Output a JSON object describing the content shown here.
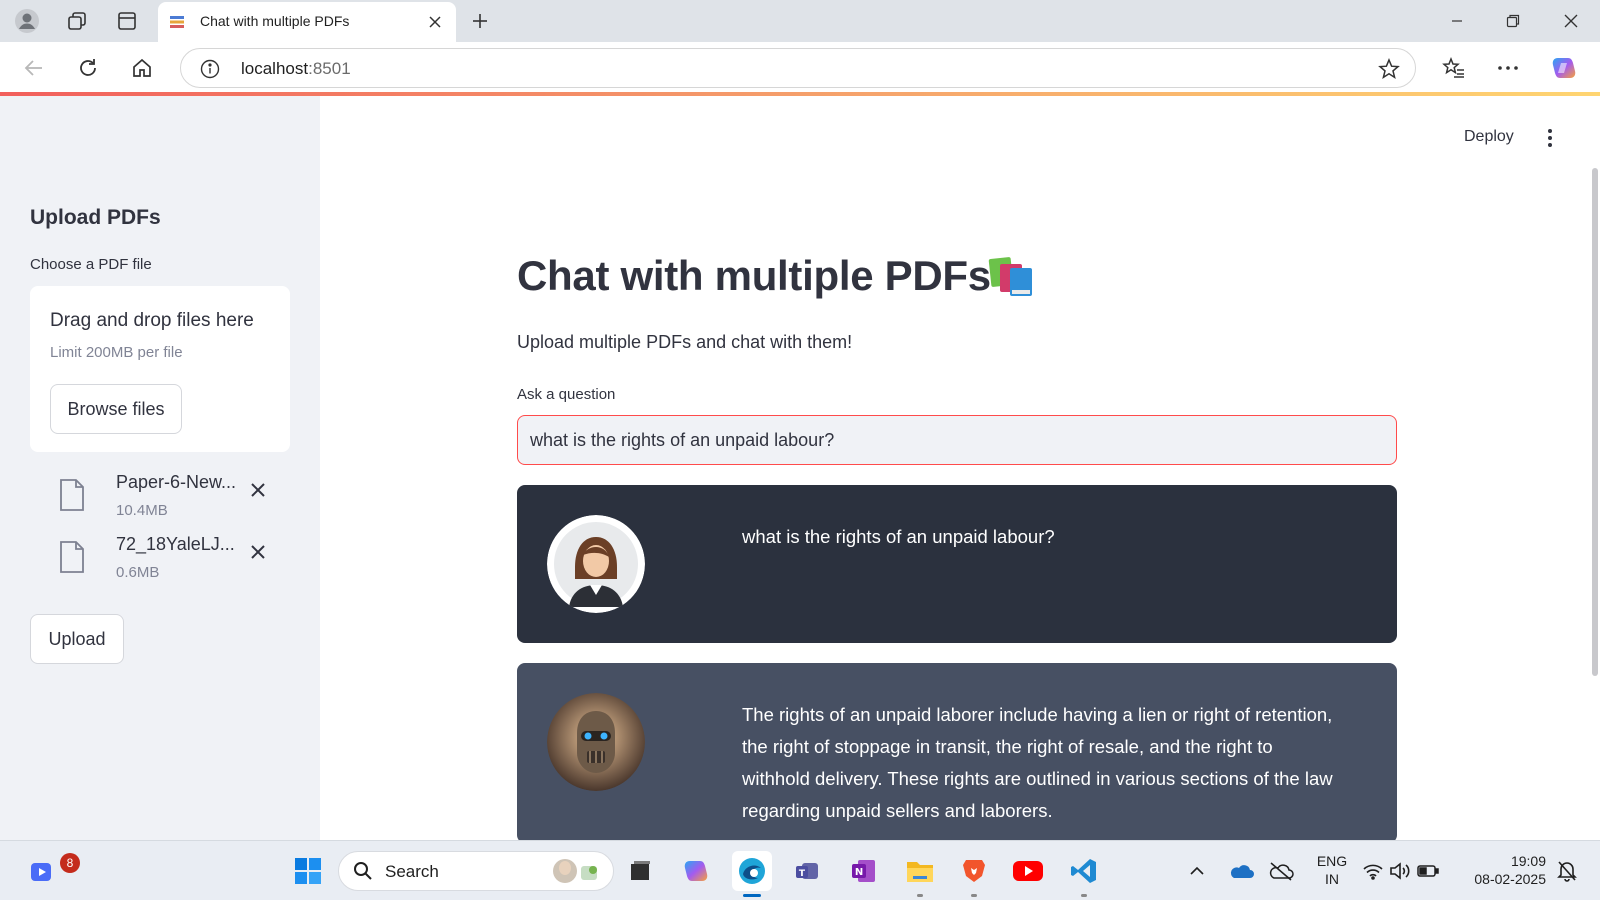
{
  "browser": {
    "tab_title": "Chat with multiple PDFs",
    "url_host": "localhost",
    "url_port": ":8501"
  },
  "app": {
    "deploy_label": "Deploy",
    "title": "Chat with multiple PDFs",
    "subtitle": "Upload multiple PDFs and chat with them!",
    "question_label": "Ask a question",
    "question_value": "what is the rights of an unpaid labour?"
  },
  "sidebar": {
    "title": "Upload PDFs",
    "uploader_label": "Choose a PDF file",
    "dropzone_title": "Drag and drop files here",
    "dropzone_limit": "Limit 200MB per file",
    "browse_label": "Browse files",
    "files": [
      {
        "name": "Paper-6-New...",
        "size": "10.4MB"
      },
      {
        "name": "72_18YaleLJ...",
        "size": "0.6MB"
      }
    ],
    "upload_label": "Upload"
  },
  "chat": {
    "user_message": "what is the rights of an unpaid labour?",
    "bot_message": "The rights of an unpaid laborer include having a lien or right of retention, the right of stoppage in transit, the right of resale, and the right to withhold delivery. These rights are outlined in various sections of the law regarding unpaid sellers and laborers."
  },
  "taskbar": {
    "search_label": "Search",
    "notification_count": "8",
    "lang_primary": "ENG",
    "lang_region": "IN",
    "time": "19:09",
    "date": "08-02-2025"
  },
  "colors": {
    "accent": "#ff4b4b",
    "sidebar_bg": "#f0f2f6",
    "user_bubble": "#2b313e",
    "bot_bubble": "#475063"
  }
}
